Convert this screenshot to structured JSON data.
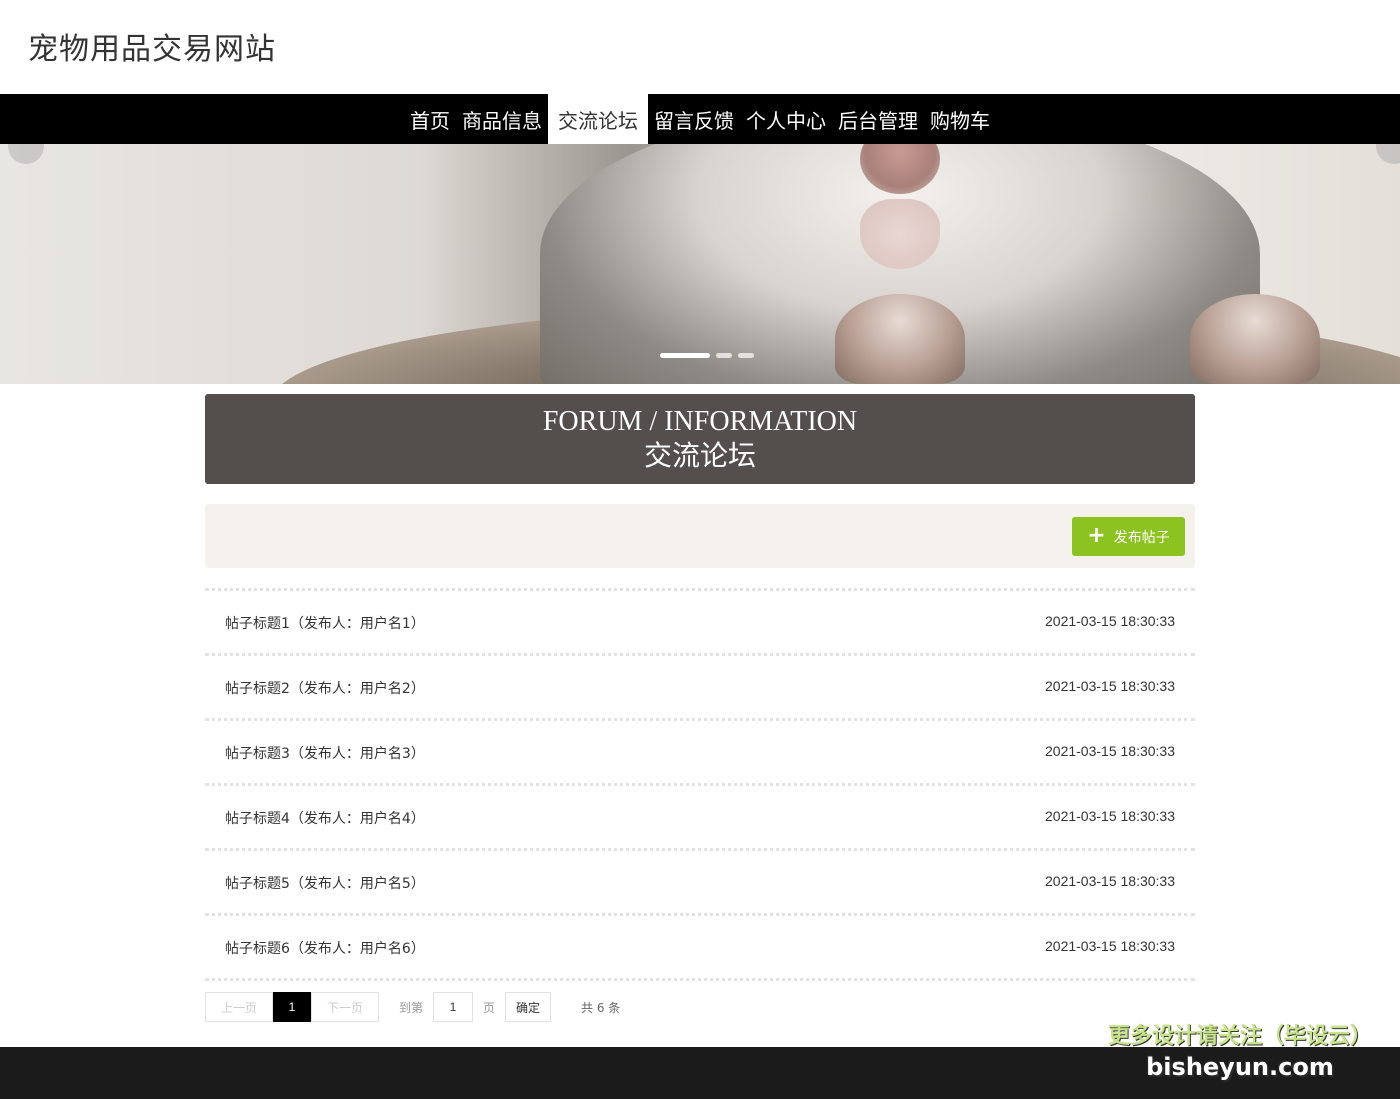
{
  "header": {
    "site_title": "宠物用品交易网站"
  },
  "nav": {
    "items": [
      {
        "label": "首页"
      },
      {
        "label": "商品信息"
      },
      {
        "label": "交流论坛"
      },
      {
        "label": "留言反馈"
      },
      {
        "label": "个人中心"
      },
      {
        "label": "后台管理"
      },
      {
        "label": "购物车"
      }
    ],
    "active_index": 2
  },
  "banner": {
    "slide_count": 3,
    "active_slide": 1
  },
  "forum_head": {
    "title_en": "FORUM / INFORMATION",
    "title_cn": "交流论坛"
  },
  "toolbar": {
    "publish_label": "发布帖子"
  },
  "posts": [
    {
      "title": "帖子标题1（发布人：用户名1）",
      "time": "2021-03-15 18:30:33"
    },
    {
      "title": "帖子标题2（发布人：用户名2）",
      "time": "2021-03-15 18:30:33"
    },
    {
      "title": "帖子标题3（发布人：用户名3）",
      "time": "2021-03-15 18:30:33"
    },
    {
      "title": "帖子标题4（发布人：用户名4）",
      "time": "2021-03-15 18:30:33"
    },
    {
      "title": "帖子标题5（发布人：用户名5）",
      "time": "2021-03-15 18:30:33"
    },
    {
      "title": "帖子标题6（发布人：用户名6）",
      "time": "2021-03-15 18:30:33"
    }
  ],
  "pager": {
    "prev_label": "上一页",
    "current_page": "1",
    "next_label": "下一页",
    "goto_label": "到第",
    "page_input_value": "1",
    "page_unit": "页",
    "confirm_label": "确定",
    "total_text": "共 6 条"
  },
  "watermark": {
    "line1": "更多设计请关注（毕设云）",
    "line2": "bisheyun.com"
  },
  "colors": {
    "nav_bg": "#000000",
    "forum_head_bg": "#544e4d",
    "toolbar_bg": "#f5f1ed",
    "accent_green": "#8cc321",
    "footer_bg": "#1b1b1b"
  }
}
